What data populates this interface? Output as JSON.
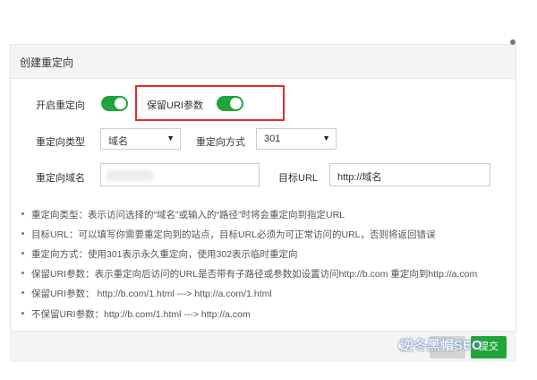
{
  "dialog": {
    "title": "创建重定向"
  },
  "form": {
    "enable_redirect_label": "开启重定向",
    "keep_uri_label": "保留URI参数",
    "redirect_type_label": "重定向类型",
    "redirect_type_value": "域名",
    "redirect_method_label": "重定向方式",
    "redirect_method_value": "301",
    "redirect_domain_label": "重定向域名",
    "target_url_label": "目标URL",
    "target_url_value": "http://域名"
  },
  "toggles": {
    "enable_redirect": true,
    "keep_uri": true,
    "on_color": "#20a53a"
  },
  "notes": [
    "重定向类型：表示访问选择的“域名”或输入的“路径”时将会重定向到指定URL",
    "目标URL：可以填写你需要重定向到的站点，目标URL必须为可正常访问的URL，否则将返回错误",
    "重定向方式：使用301表示永久重定向，使用302表示临时重定向",
    "保留URI参数：表示重定向后访问的URL是否带有子路径或参数如设置访问http://b.com 重定向到http://a.com",
    "保留URI参数：  http://b.com/1.html ---> http://a.com/1.html",
    "不保留URI参数：http://b.com/1.html ---> http://a.com"
  ],
  "buttons": {
    "close": "关闭",
    "submit": "提交"
  },
  "watermark": "逆冬黑帽SEO",
  "colors": {
    "highlight": "#e12b2b",
    "accent": "#20a53a"
  }
}
